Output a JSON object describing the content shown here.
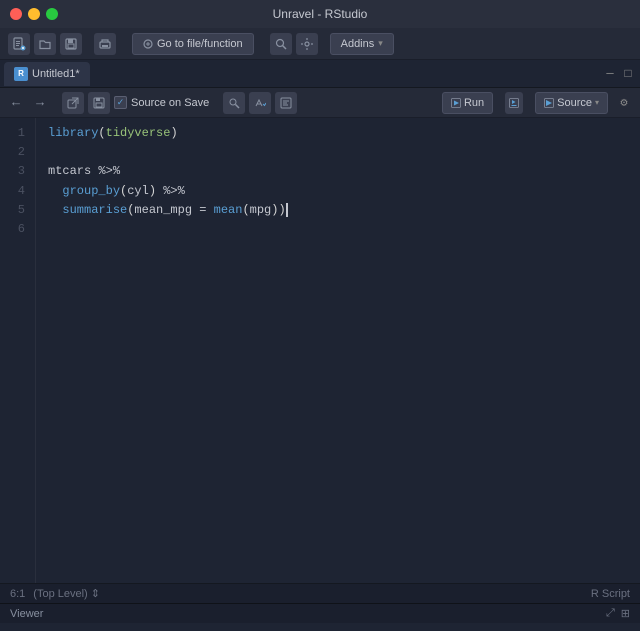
{
  "titleBar": {
    "title": "Unravel - RStudio"
  },
  "menuBar": {
    "gotoLabel": "Go to file/function",
    "addinsLabel": "Addins",
    "addinsArrow": "▾"
  },
  "tab": {
    "name": "Untitled1",
    "modified": true,
    "closeChar": "×"
  },
  "editorToolbar": {
    "sourceOnSave": "Source on Save",
    "runLabel": "Run",
    "sourceLabel": "Source",
    "dropdownArrow": "▾"
  },
  "lineNumbers": [
    "1",
    "2",
    "3",
    "4",
    "5",
    "6"
  ],
  "codeLines": [
    {
      "content": "library(tidyverse)",
      "type": "library"
    },
    {
      "content": "",
      "type": "blank"
    },
    {
      "content": "mtcars %>%",
      "type": "pipe"
    },
    {
      "content": "  group_by(cyl) %>%",
      "type": "pipe"
    },
    {
      "content": "  summarise(mean_mpg = mean(mpg))",
      "type": "fn"
    },
    {
      "content": "",
      "type": "blank"
    }
  ],
  "statusBar": {
    "position": "6:1",
    "level": "(Top Level)",
    "levelArrow": "⇕",
    "scriptType": "R Script"
  },
  "bottomBar": {
    "viewerLabel": "Viewer",
    "icons": [
      "resize-icon",
      "expand-icon"
    ]
  }
}
